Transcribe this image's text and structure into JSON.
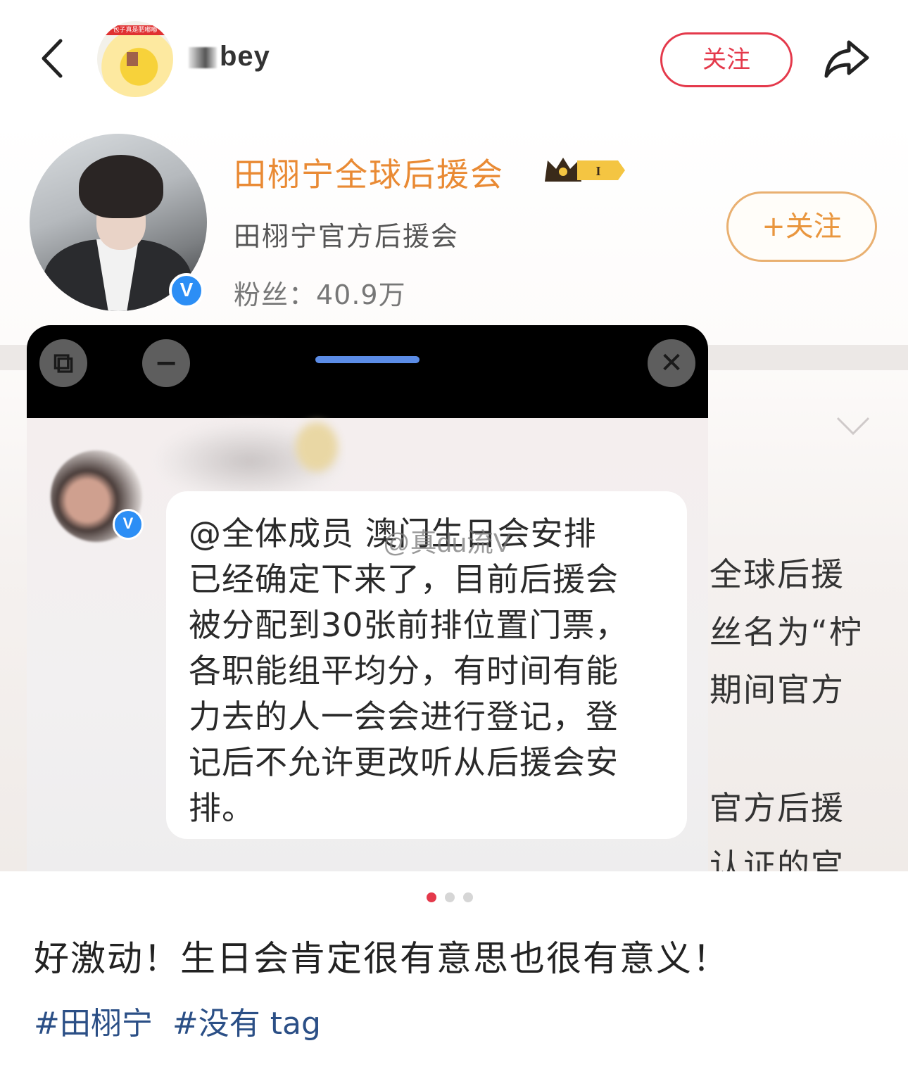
{
  "header": {
    "username": "bey",
    "avatar_ribbon": "包子真是肥嘟嘟",
    "follow_label": "关注",
    "icons": [
      "back-icon",
      "share-icon"
    ],
    "accent": "#e4394b"
  },
  "image": {
    "profile": {
      "name": "田栩宁全球后援会",
      "level_badge": "I",
      "description": "田栩宁官方后援会",
      "fans": "粉丝：40.9万",
      "verify_mark": "V",
      "follow_label": "+关注",
      "name_color": "#e98a34"
    },
    "float_window": {
      "buttons": [
        "expand-icon",
        "minimize-icon",
        "close-icon"
      ],
      "expand_glyph": "⧉",
      "minimize_glyph": "−",
      "close_glyph": "✕"
    },
    "chat": {
      "verify_mark": "V",
      "message_lines": [
        "@全体成员 澳门生日会安排",
        "已经确定下来了，目前后援会",
        "被分配到30张前排位置门票，",
        "各职能组平均分，有时间有能",
        "力去的人一会会进行登记，登",
        "记后不允许更改听从后援会安",
        "排。"
      ],
      "watermark": "@真du流V"
    },
    "right_partial_lines": [
      "全球后援",
      "丝名为“柠",
      "期间官方",
      "官方后援",
      "认证的官"
    ]
  },
  "pagination": {
    "count": 3,
    "active": 0,
    "active_color": "#e4394b"
  },
  "caption": "好激动！生日会肯定很有意思也很有意义！",
  "tags": [
    "#田栩宁",
    "#没有 tag"
  ],
  "tag_color": "#2b4f86"
}
